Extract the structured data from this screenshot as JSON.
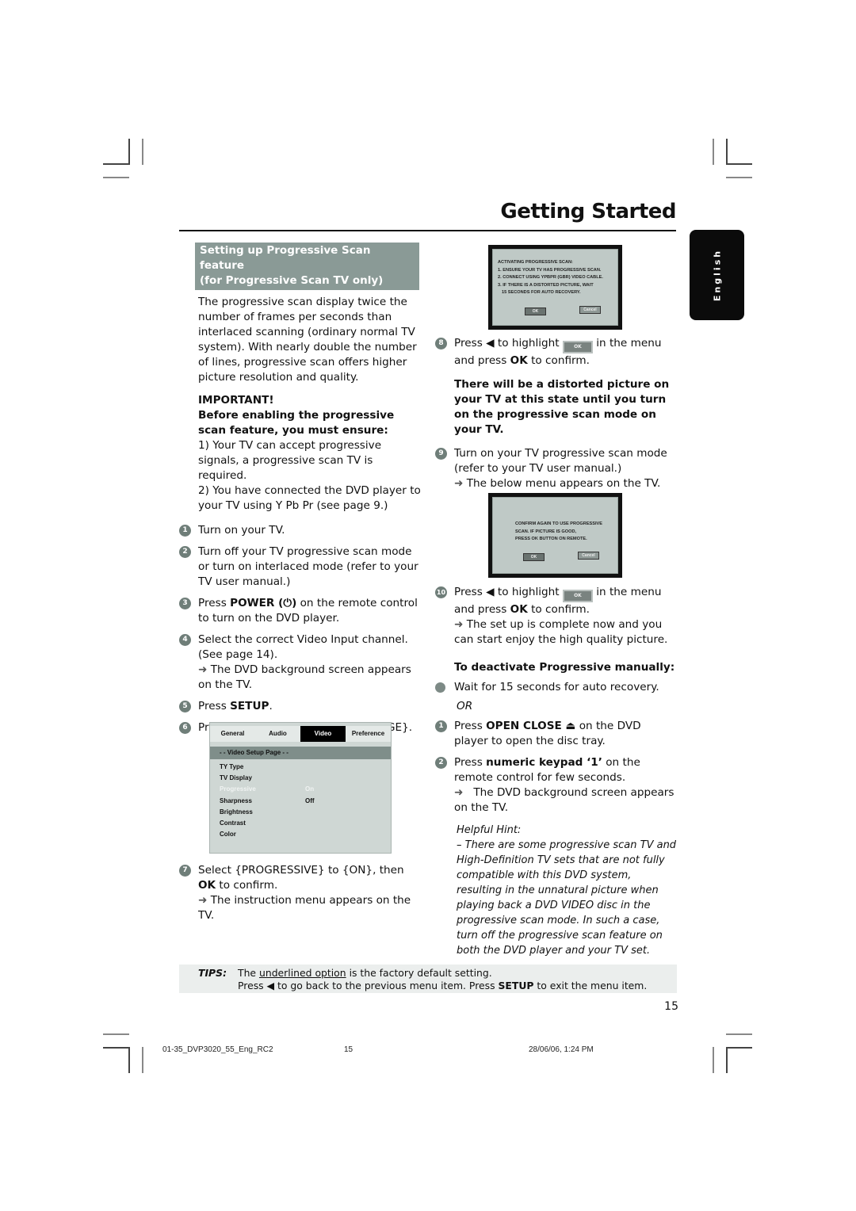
{
  "page": {
    "title": "Getting Started",
    "language_tab": "English",
    "page_number": "15"
  },
  "left_column": {
    "section_heading_line1": "Setting up Progressive Scan feature",
    "section_heading_line2": "(for Progressive Scan TV only)",
    "intro": "The progressive scan display twice the number of frames per seconds than interlaced scanning (ordinary normal TV system). With nearly double the number of lines, progressive scan offers higher picture resolution and quality.",
    "important_label": "IMPORTANT!",
    "important_lead": "Before enabling the progressive scan feature, you must ensure:",
    "requirements": [
      "1) Your TV can accept progressive signals, a progressive scan TV is required.",
      "2) You have connected the DVD player to your TV using Y Pb Pr (see page 9.)"
    ],
    "steps": [
      {
        "num": "1",
        "text": "Turn on your TV."
      },
      {
        "num": "2",
        "text": "Turn off your TV progressive scan mode or turn on interlaced mode (refer to your TV user manual.)"
      },
      {
        "num": "3",
        "pre": "Press ",
        "bold": "POWER (⏻)",
        "post": " on the remote control to turn on the DVD player."
      },
      {
        "num": "4",
        "text": "Select the correct Video Input channel. (See page 14).",
        "result": "The DVD background screen appears on the TV."
      },
      {
        "num": "5",
        "pre": "Press ",
        "bold": "SETUP",
        "post": "."
      },
      {
        "num": "6",
        "pre": "Press ▶ to select {VIDEO SETUP PAGE}."
      },
      {
        "num": "7",
        "pre": "Select {PROGRESSIVE} to {ON}, then ",
        "bold": "OK",
        "post": " to confirm.",
        "result": "The instruction menu appears on the TV."
      }
    ]
  },
  "setup_menu": {
    "tabs": [
      "General",
      "Audio",
      "Video",
      "Preference"
    ],
    "active_tab": "Video",
    "page_title": "- -  Video Setup Page  - -",
    "rows": [
      {
        "label": "TY Type",
        "value": ""
      },
      {
        "label": "TV Display",
        "value": ""
      },
      {
        "label": "Progressive",
        "value": "On",
        "highlighted": true
      },
      {
        "label": "Sharpness",
        "value": "Off"
      },
      {
        "label": "Brightness",
        "value": ""
      },
      {
        "label": "Contrast",
        "value": ""
      },
      {
        "label": "Color",
        "value": ""
      }
    ]
  },
  "tv_screen_1": {
    "lines": [
      "ACTIVATING PROGRESSIVE SCAN:",
      "1. ENSURE YOUR TV HAS PROGRESSIVE SCAN.",
      "2. CONNECT USING YPBPR (GBR) VIDEO CABLE.",
      "3. IF THERE IS A DISTORTED PICTURE, WAIT",
      "   15 SECONDS FOR AUTO RECOVERY."
    ],
    "ok_label": "OK",
    "cancel_label": "Cancel"
  },
  "tv_screen_2": {
    "lines": [
      "CONFIRM AGAIN TO USE PROGRESSIVE",
      "SCAN. IF PICTURE IS GOOD,",
      "PRESS OK BUTTON ON REMOTE."
    ],
    "ok_label": "OK",
    "cancel_label": "Cancel"
  },
  "right_column": {
    "step8": {
      "num": "8",
      "pre": "Press ◀ to highlight",
      "post": "in the menu and press ",
      "bold": "OK",
      "end": " to confirm.",
      "chip": "OK"
    },
    "warning": "There will be a distorted picture on your TV at this state until you turn on the progressive scan mode on your TV.",
    "step9": {
      "num": "9",
      "text": "Turn on your TV progressive scan mode (refer to your TV user manual.)",
      "result": "The below menu appears on the TV."
    },
    "step10": {
      "num": "10",
      "pre": "Press ◀ to highlight",
      "post": "in the menu and press ",
      "bold": "OK",
      "end": " to confirm.",
      "chip": "OK",
      "result": "The set up is complete now and you can start enjoy the high quality picture."
    },
    "deactivate_heading": "To deactivate Progressive manually:",
    "bullet": "Wait for 15 seconds for auto recovery.",
    "or_label": "OR",
    "deact_steps": [
      {
        "num": "1",
        "pre": "Press ",
        "bold": "OPEN CLOSE ⏏",
        "post": " on the DVD player to open the disc tray."
      },
      {
        "num": "2",
        "pre": "Press ",
        "bold": "numeric keypad ‘1’",
        "post": " on the remote control for few seconds.",
        "result": "The DVD background screen appears on the TV."
      }
    ],
    "hint_title": "Helpful Hint:",
    "hint_text": "–   There are some progressive scan TV and High-Definition TV sets that are not fully compatible with this DVD system, resulting in the unnatural picture when playing back a DVD VIDEO disc in the progressive scan mode.  In such a case, turn off the progressive scan feature on both the DVD player and your TV set."
  },
  "tips": {
    "label": "TIPS:",
    "line1_pre": "The ",
    "line1_underlined": "underlined option",
    "line1_post": " is the factory default setting.",
    "line2_pre": "Press ◀ to go back to the previous menu item. Press ",
    "line2_bold": "SETUP",
    "line2_post": " to exit the menu item."
  },
  "print_footer": {
    "file": "01-35_DVP3020_55_Eng_RC2",
    "page": "15",
    "timestamp": "28/06/06, 1:24 PM"
  }
}
